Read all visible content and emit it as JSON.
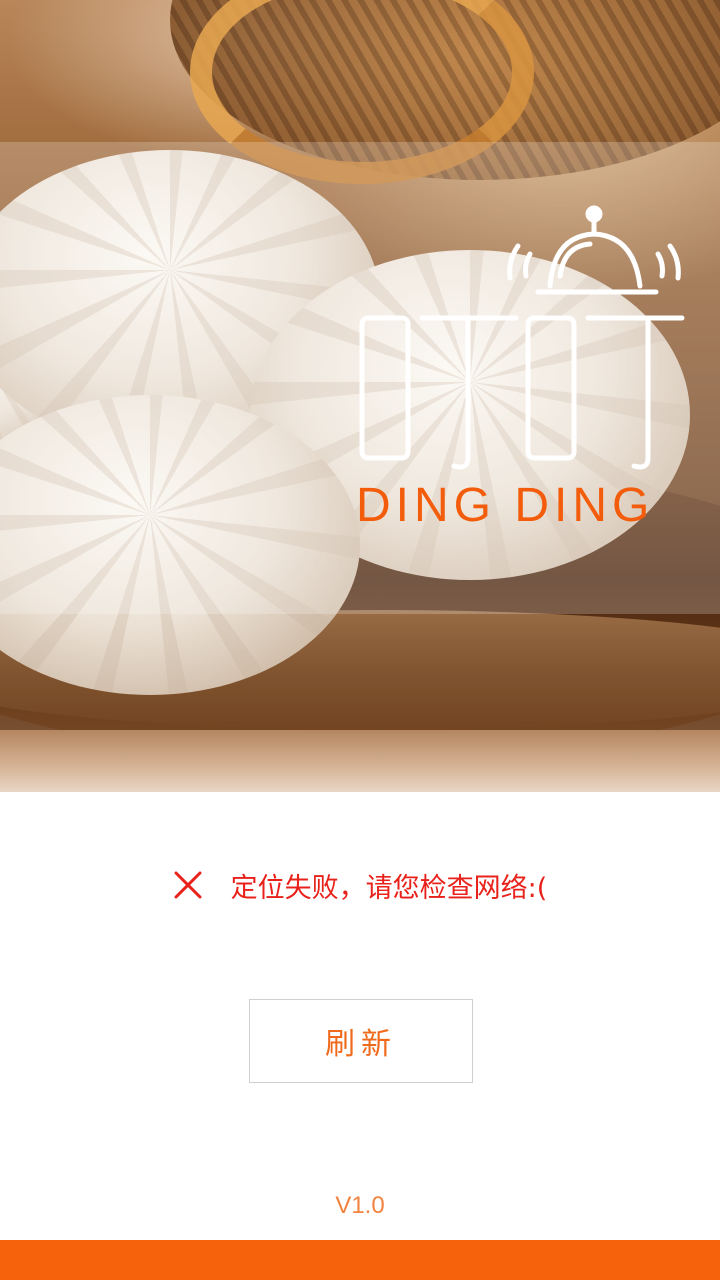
{
  "brand": {
    "name_cn": "叮叮",
    "name_en": "DING DING",
    "accent_color": "#f25c0a"
  },
  "status": {
    "icon": "close-icon",
    "message": "定位失败，请您检查网络:(",
    "color": "#e8221b"
  },
  "refresh_button": {
    "label": "刷新"
  },
  "version": "V1.0",
  "bottom_bar_color": "#f6620c"
}
